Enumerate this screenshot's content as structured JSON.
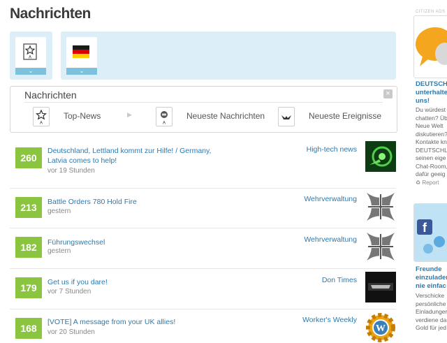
{
  "page": {
    "title": "Nachrichten"
  },
  "menu": {
    "title": "Nachrichten",
    "close": "×",
    "items": [
      {
        "label": "Top-News"
      },
      {
        "label": "Neueste Nachrichten"
      },
      {
        "label": "Neueste Ereignisse"
      }
    ]
  },
  "news": [
    {
      "score": "260",
      "title": "Deutschland, Lettland kommt zur Hilfe! / Germany, Latvia comes to help!",
      "time": "vor 19 Stunden",
      "source": "High-tech news",
      "thumb": "green-emblem"
    },
    {
      "score": "213",
      "title": "Battle Orders 780 Hold Fire",
      "time": "gestern",
      "source": "Wehrverwaltung",
      "thumb": "iron-cross"
    },
    {
      "score": "182",
      "title": "Führungswechsel",
      "time": "gestern",
      "source": "Wehrverwaltung",
      "thumb": "iron-cross"
    },
    {
      "score": "179",
      "title": "Get us if you dare!",
      "time": "vor 7 Stunden",
      "source": "Don Times",
      "thumb": "don-logo"
    },
    {
      "score": "168",
      "title": "[VOTE] A message from your UK allies!",
      "time": "vor 20 Stunden",
      "source": "Worker's Weekly",
      "thumb": "wordpress-gear"
    }
  ],
  "sidebar": {
    "ads_label": "CITIZEN ADS",
    "ad1": {
      "heading": [
        "DEUTSCH",
        "unterhalte",
        "uns!"
      ],
      "text": [
        "Du würdest",
        "chatten? Üb",
        "Neue Welt",
        "diskutieren?",
        "Kontakte kn",
        "DEUTSCHLA",
        "seinen eige",
        "Chat-Room,",
        "dafür geeig"
      ],
      "report": "Report"
    },
    "ad2": {
      "heading": [
        "Freunde",
        "einzuladen",
        "nie einfac"
      ],
      "text": [
        "Verschicke",
        "persönliche",
        "Einladunger",
        "verdiene da",
        "Gold für jed"
      ]
    }
  },
  "colors": {
    "score_bg": "#8bc53f",
    "link": "#2b7ab0",
    "filter_bg": "#dceef7"
  }
}
